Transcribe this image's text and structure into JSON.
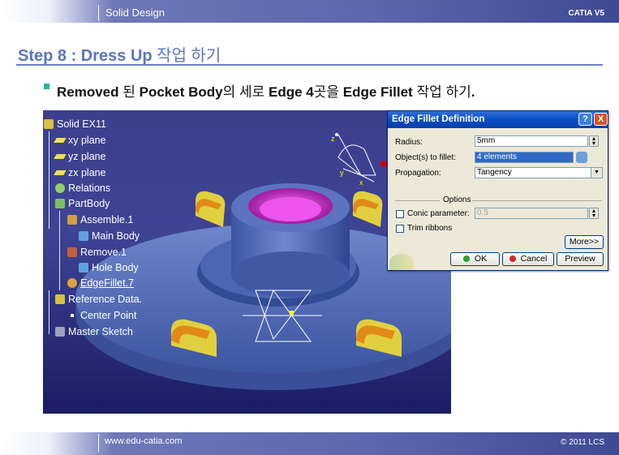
{
  "header": {
    "title": "Solid Design",
    "brand": "CATIA V5"
  },
  "step": {
    "prefix": "Step 8 : Dress Up",
    "suffix": "작업 하기"
  },
  "description": {
    "p1": "Removed",
    "p2": " 된 ",
    "p3": "Pocket Body",
    "p4": "의 세로 ",
    "p5": "Edge 4",
    "p6": "곳을 ",
    "p7": "Edge Fillet",
    "p8": " 작업 하기",
    "p9": "."
  },
  "tree": {
    "root": "Solid EX11",
    "xy": "xy plane",
    "yz": "yz plane",
    "zx": "zx plane",
    "relations": "Relations",
    "partbody": "PartBody",
    "assemble": "Assemble.1",
    "mainbody": "Main Body",
    "remove": "Remove.1",
    "holebody": "Hole Body",
    "edgefillet": "EdgeFillet.7",
    "refdata": "Reference Data.",
    "centerpoint": "Center Point",
    "mastersketch": "Master Sketch"
  },
  "compass": {
    "z": "z",
    "y": "y",
    "x": "x"
  },
  "dialog": {
    "title": "Edge Fillet Definition",
    "help": "?",
    "close": "X",
    "radius_label": "Radius:",
    "radius_value": "5mm",
    "objects_label": "Object(s) to fillet:",
    "objects_value": "4 elements",
    "propagation_label": "Propagation:",
    "propagation_value": "Tangency",
    "options_label": "Options",
    "conic_label": "Conic parameter:",
    "conic_value": "0.5",
    "trim_label": "Trim ribbons",
    "more": "More>>",
    "ok": "OK",
    "cancel": "Cancel",
    "preview": "Preview"
  },
  "footer": {
    "site": "www.edu-catia.com",
    "copyright": "© 2011 LCS"
  },
  "colors": {
    "accent": "#5a74c4",
    "viewport_bg": "#3b3f8c",
    "part": "#4f6bb4",
    "fillet": "#e08a1a",
    "pocket": "#cc33cc"
  }
}
